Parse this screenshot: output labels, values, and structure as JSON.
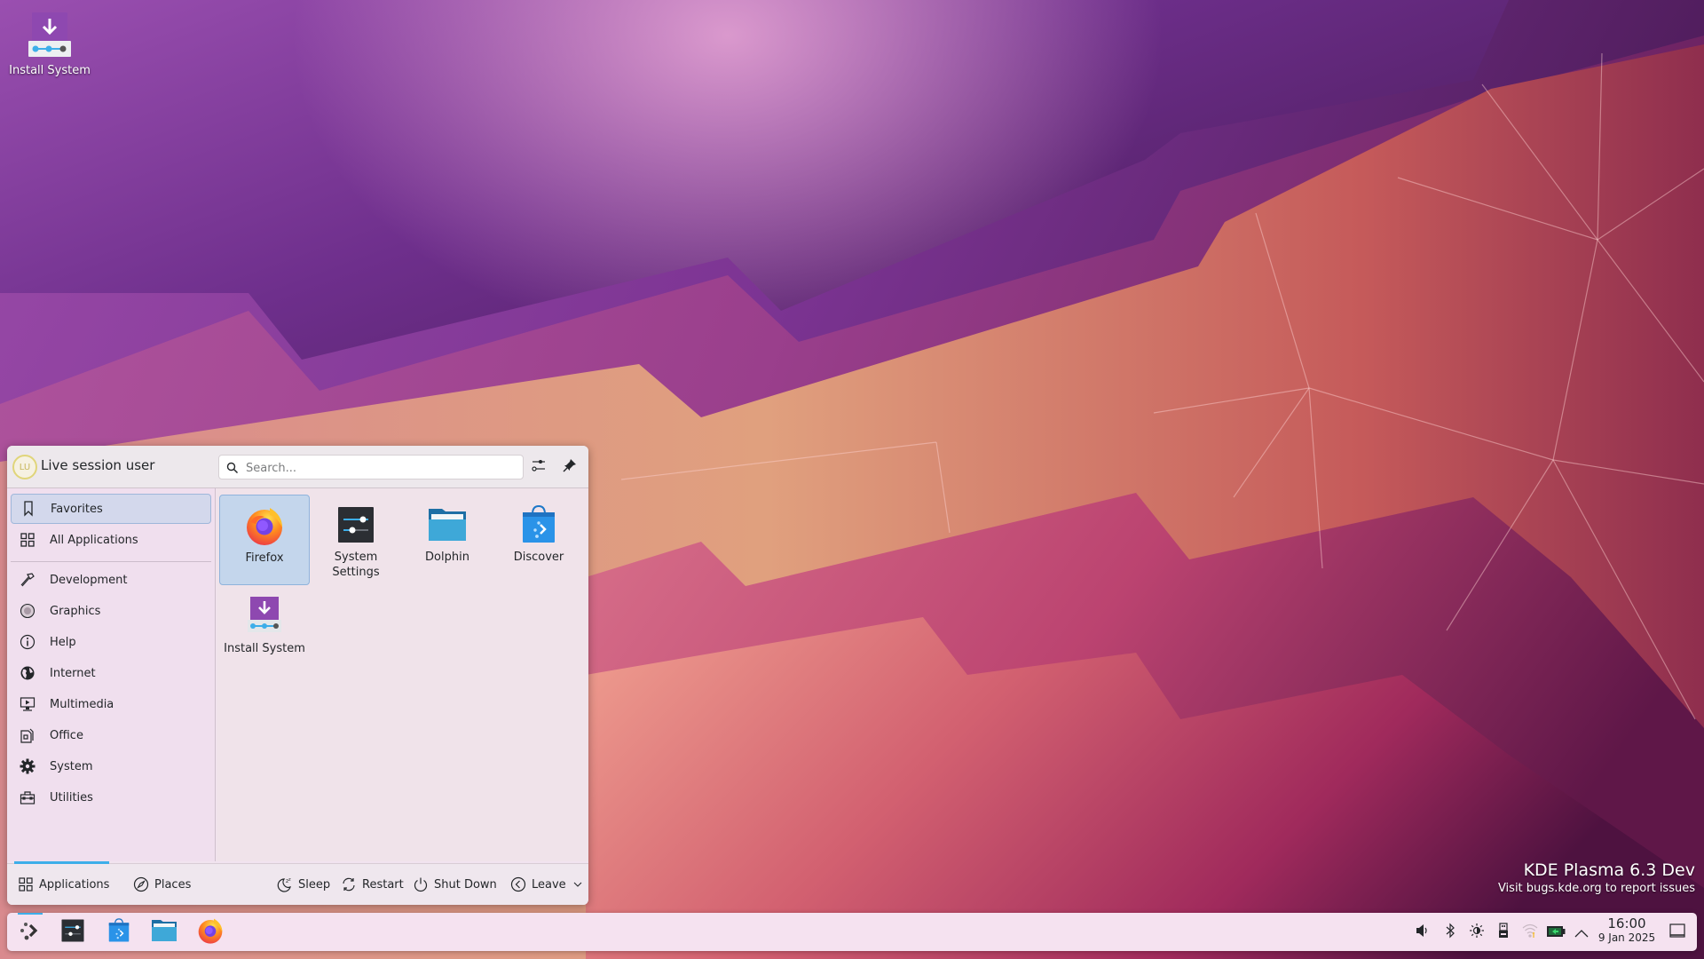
{
  "desktop": {
    "icons": [
      {
        "label": "Install System",
        "icon": "install-system-icon"
      }
    ],
    "watermark": {
      "title": "KDE Plasma 6.3 Dev",
      "subtitle": "Visit bugs.kde.org to report issues"
    }
  },
  "menu": {
    "user": {
      "name": "Live session user",
      "avatar_initials": "LU"
    },
    "search": {
      "placeholder": "Search...",
      "value": ""
    },
    "header_buttons": [
      {
        "name": "configure",
        "icon": "sliders-icon"
      },
      {
        "name": "pin",
        "icon": "pin-icon"
      }
    ],
    "sidebar": {
      "top_items": [
        {
          "label": "Favorites",
          "icon": "bookmark-icon",
          "active": true
        },
        {
          "label": "All Applications",
          "icon": "grid-icon",
          "active": false
        }
      ],
      "categories": [
        {
          "label": "Development",
          "icon": "hammer-icon"
        },
        {
          "label": "Graphics",
          "icon": "graphics-icon"
        },
        {
          "label": "Help",
          "icon": "info-icon"
        },
        {
          "label": "Internet",
          "icon": "globe-icon"
        },
        {
          "label": "Multimedia",
          "icon": "monitor-play-icon"
        },
        {
          "label": "Office",
          "icon": "office-icon"
        },
        {
          "label": "System",
          "icon": "gear-icon"
        },
        {
          "label": "Utilities",
          "icon": "toolbox-icon"
        }
      ]
    },
    "favorites": [
      {
        "label": "Firefox",
        "icon": "firefox-icon",
        "active": true
      },
      {
        "label": "System Settings",
        "icon": "system-settings-icon",
        "active": false
      },
      {
        "label": "Dolphin",
        "icon": "folder-icon",
        "active": false
      },
      {
        "label": "Discover",
        "icon": "discover-icon",
        "active": false
      },
      {
        "label": "Install System",
        "icon": "install-system-icon",
        "active": false
      }
    ],
    "footer": {
      "tabs": [
        {
          "label": "Applications",
          "icon": "grid-icon",
          "active": true
        },
        {
          "label": "Places",
          "icon": "compass-icon",
          "active": false
        }
      ],
      "actions": [
        {
          "label": "Sleep",
          "icon": "sleep-icon"
        },
        {
          "label": "Restart",
          "icon": "restart-icon"
        },
        {
          "label": "Shut Down",
          "icon": "power-icon"
        },
        {
          "label": "Leave",
          "icon": "leave-icon"
        }
      ]
    }
  },
  "panel": {
    "tasks": [
      {
        "name": "application-launcher",
        "icon": "kde-launcher-icon"
      },
      {
        "name": "system-settings",
        "icon": "system-settings-icon"
      },
      {
        "name": "discover",
        "icon": "discover-icon"
      },
      {
        "name": "dolphin",
        "icon": "folder-icon"
      },
      {
        "name": "firefox",
        "icon": "firefox-icon"
      }
    ],
    "tray": [
      {
        "name": "volume",
        "icon": "volume-icon"
      },
      {
        "name": "bluetooth",
        "icon": "bluetooth-icon"
      },
      {
        "name": "brightness",
        "icon": "brightness-icon"
      },
      {
        "name": "removable-device",
        "icon": "usb-drive-icon"
      },
      {
        "name": "network",
        "icon": "wifi-icon"
      },
      {
        "name": "battery",
        "icon": "battery-icon"
      },
      {
        "name": "show-hidden",
        "icon": "chevron-up-icon"
      }
    ],
    "clock": {
      "time": "16:00",
      "date": "9 Jan 2025"
    },
    "show_desktop": {
      "icon": "show-desktop-icon"
    }
  },
  "colors": {
    "accent": "#3daee9",
    "selection_bg": "#c4d6ec",
    "menu_bg": "#f1e3ef",
    "panel_bg": "#f5e2f0"
  }
}
